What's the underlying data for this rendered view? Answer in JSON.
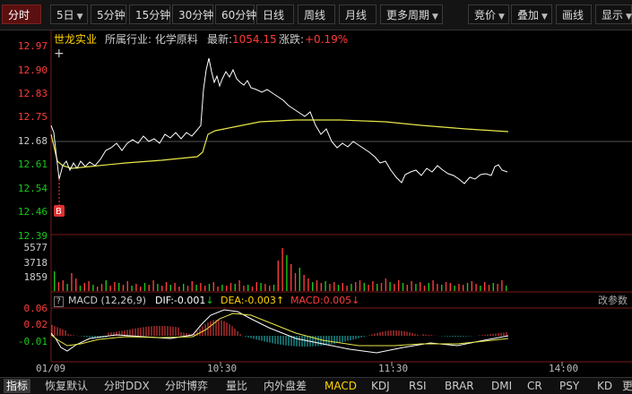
{
  "toolbar": {
    "buttons": [
      {
        "label": "分时",
        "active": true
      },
      {
        "label": "5日",
        "dropdown": true
      },
      {
        "label": "5分钟"
      },
      {
        "label": "15分钟"
      },
      {
        "label": "30分钟"
      },
      {
        "label": "60分钟"
      },
      {
        "label": "日线"
      },
      {
        "label": "周线"
      },
      {
        "label": "月线"
      },
      {
        "label": "更多周期",
        "dropdown": true
      },
      {
        "label": "竞价",
        "dropdown": true
      },
      {
        "label": "叠加",
        "dropdown": true
      },
      {
        "label": "画线"
      },
      {
        "label": "显示",
        "dropdown": true
      }
    ]
  },
  "info": {
    "name": "世龙实业",
    "industry": "所属行业: 化学原料",
    "latest_label": "最新:",
    "latest_value": "1054.15",
    "change_label": "涨跌:",
    "change_value": "+0.19%"
  },
  "price_axis": {
    "labels": [
      "12.97",
      "12.90",
      "12.83",
      "12.75",
      "12.68",
      "12.61",
      "12.54",
      "12.46",
      "12.39"
    ],
    "ref_price": "12.68"
  },
  "volume_axis": {
    "labels": [
      "5577",
      "3718",
      "1859"
    ]
  },
  "macd": {
    "title": "MACD (12,26,9)",
    "dif": "DIF:-0.001",
    "dea": "DEA:-0.003",
    "macd": "MACD:0.005",
    "adjust": "改参数",
    "axis": [
      "0.06",
      "0.02",
      "-0.01"
    ]
  },
  "time_axis": [
    "01/09",
    "10:30",
    "11:30",
    "14:00"
  ],
  "marker": "B",
  "colors": {
    "up": "#ff3b3b",
    "down": "#19c819",
    "price": "#ffffff",
    "avg": "#e8e84a",
    "dif": "#ffffff",
    "dea": "#e8e84a",
    "macdpos": "#ff4444",
    "macdneg": "#22c8c8",
    "accent": "#ffd400"
  },
  "bottom_tabs": [
    {
      "label": "指标",
      "first": true
    },
    {
      "label": "恢复默认"
    },
    {
      "label": "分时DDX"
    },
    {
      "label": "分时博弈"
    },
    {
      "label": "量比"
    },
    {
      "label": "内外盘差"
    },
    {
      "label": "MACD",
      "active": true
    },
    {
      "label": "KDJ"
    },
    {
      "label": "RSI"
    },
    {
      "label": "BRAR"
    },
    {
      "label": "DMI"
    },
    {
      "label": "CR"
    },
    {
      "label": "PSY"
    },
    {
      "label": "KD"
    },
    {
      "label": "更"
    }
  ]
}
